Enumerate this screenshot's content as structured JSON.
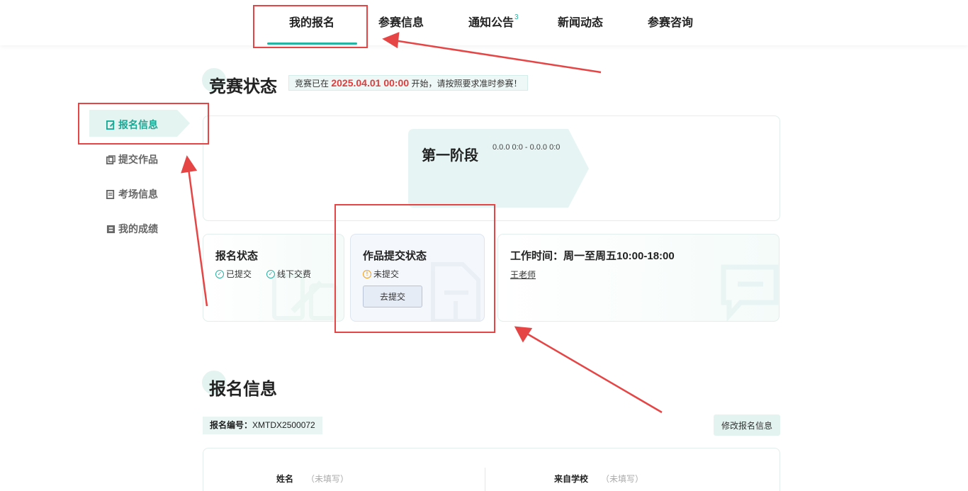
{
  "nav": {
    "items": [
      {
        "label": "我的报名"
      },
      {
        "label": "参赛信息"
      },
      {
        "label": "通知公告",
        "badge": "3"
      },
      {
        "label": "新闻动态"
      },
      {
        "label": "参赛咨询"
      }
    ],
    "active": "我的报名"
  },
  "sidebar": {
    "items": [
      {
        "label": "报名信息",
        "icon": "edit-icon"
      },
      {
        "label": "提交作品",
        "icon": "file-icon"
      },
      {
        "label": "考场信息",
        "icon": "document-icon"
      },
      {
        "label": "我的成绩",
        "icon": "report-icon"
      }
    ],
    "active": "报名信息"
  },
  "competition": {
    "title": "竞赛状态",
    "notice_prefix": "竞赛已在",
    "start_time": "2025.04.01 00:00",
    "notice_suffix": "开始，请按照要求准时参赛！",
    "stage_name": "第一阶段",
    "stage_time": "0.0.0 0:0 - 0.0.0 0:0"
  },
  "status": {
    "registration": {
      "title": "报名状态",
      "tag1": "已提交",
      "tag2": "线下交费"
    },
    "submission": {
      "title": "作品提交状态",
      "state": "未提交",
      "button": "去提交"
    },
    "contact": {
      "title": "工作时间：周一至周五10:00-18:00",
      "teacher": "王老师"
    }
  },
  "registration_info": {
    "title": "报名信息",
    "number_label": "报名编号：",
    "number": "XMTDX2500072",
    "edit_button": "修改报名信息",
    "fields": [
      {
        "label": "姓名",
        "value": "（未填写）"
      },
      {
        "label": "来自学校",
        "value": "（未填写）"
      }
    ]
  },
  "colors": {
    "accent": "#27b3a3",
    "highlight": "#e03c3c",
    "annotation": "#e64545"
  }
}
